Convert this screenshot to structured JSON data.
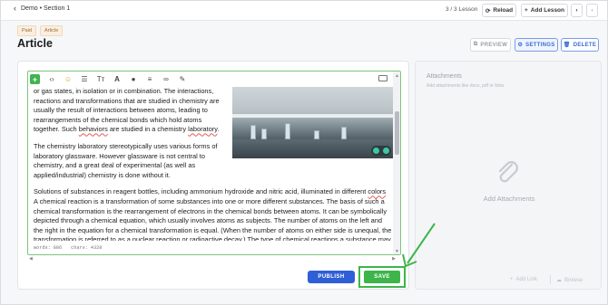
{
  "topbar": {
    "back_label": "Demo • Section 1",
    "lesson_count": "3 / 3 Lesson",
    "reload_label": "Reload",
    "add_lesson_label": "Add Lesson",
    "prev_glyph": "‹",
    "next_glyph": "›"
  },
  "header": {
    "tags": [
      "Paid",
      "Article"
    ],
    "title": "Article",
    "preview_label": "PREVIEW",
    "settings_label": "SETTINGS",
    "delete_label": "DELETE"
  },
  "editor": {
    "toolbar_icons": [
      "plus-icon",
      "code-icon",
      "emoji-icon",
      "list-icon",
      "text-format-icon",
      "font-color-icon",
      "drop-icon",
      "align-icon",
      "link-icon",
      "brush-icon",
      "keyboard-icon"
    ],
    "para1_a": "or gas states, in isolation or in combination. The interactions, reactions and transformations that are studied in chemistry are usually the result of interactions between atoms, leading to rearrangements of the chemical bonds which hold atoms together. Such ",
    "para1_b": "behaviors",
    "para1_c": " are studied in a chemistry ",
    "para1_d": "laboratory",
    "para1_e": ".",
    "para2": "The chemistry laboratory stereotypically uses various forms of laboratory glassware. However glassware is not central to chemistry, and a great deal of experimental (as well as applied/industrial) chemistry is done without it.",
    "para3_a": "Solutions of substances in reagent bottles, including ammonium hydroxide and nitric acid, illuminated in different ",
    "para3_b": "colors",
    "para4": "A chemical reaction is a transformation of some substances into one or more different substances. The basis of such a chemical transformation is the rearrangement of electrons in the chemical bonds between atoms. It can be symbolically depicted through a chemical equation, which usually involves atoms as subjects. The number of atoms on the left and the right in the equation for a chemical transformation is equal. (When the number of atoms on either side is unequal, the transformation is referred to as a nuclear reaction or radioactive decay.) The type of chemical reactions a substance may",
    "words": "words: 886",
    "chars": "chars: 4328",
    "image_alt": "chemistry laboratory photo"
  },
  "footer": {
    "publish_label": "PUBLISH",
    "save_label": "SAVE"
  },
  "attachments": {
    "title": "Attachments",
    "subtitle": "Add attachments like docx, pdf or links",
    "empty_label": "Add Attachments",
    "add_link_label": "Add Link",
    "browse_label": "Browse"
  },
  "colors": {
    "accent_blue": "#2f5fd6",
    "save_green": "#3db54a",
    "editor_border": "#7cc47f"
  }
}
